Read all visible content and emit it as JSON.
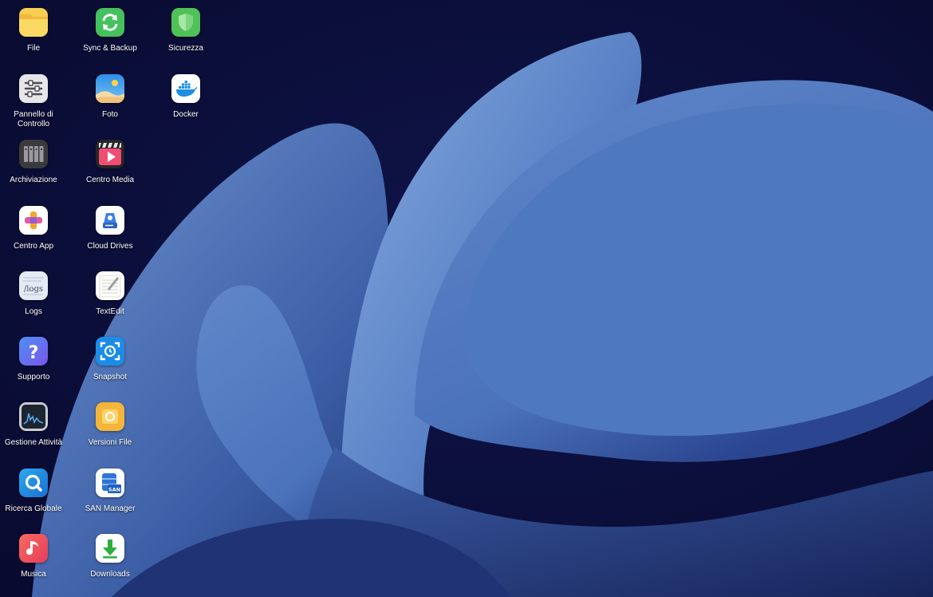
{
  "desktop": {
    "icons": [
      {
        "label": "File",
        "icon": "folder-icon",
        "color": "#f7c948"
      },
      {
        "label": "Pannello di Controllo",
        "icon": "control-panel-icon",
        "color": "#e4e4e4"
      },
      {
        "label": "Archiviazione",
        "icon": "storage-icon",
        "color": "#3a3a3a"
      },
      {
        "label": "Centro App",
        "icon": "app-center-icon",
        "color": "#ffffff"
      },
      {
        "label": "Logs",
        "icon": "logs-icon",
        "color": "#e9eef5"
      },
      {
        "label": "Supporto",
        "icon": "support-icon",
        "color": "#5b6ef5"
      },
      {
        "label": "Gestione Attività",
        "icon": "activity-monitor-icon",
        "color": "#1e2a35"
      },
      {
        "label": "Ricerca Globale",
        "icon": "global-search-icon",
        "color": "#1e8fe0"
      },
      {
        "label": "Musica",
        "icon": "music-icon",
        "color": "#f0515e"
      },
      {
        "label": "Sync & Backup",
        "icon": "sync-backup-icon",
        "color": "#3cbf5a"
      },
      {
        "label": "Foto",
        "icon": "photos-icon",
        "color": "#3d9de8"
      },
      {
        "label": "Centro Media",
        "icon": "media-center-icon",
        "color": "#2a2a2a"
      },
      {
        "label": "Cloud Drives",
        "icon": "cloud-drives-icon",
        "color": "#ffffff"
      },
      {
        "label": "TextEdit",
        "icon": "textedit-icon",
        "color": "#ffffff"
      },
      {
        "label": "Snapshot",
        "icon": "snapshot-icon",
        "color": "#1c8ee6"
      },
      {
        "label": "Versioni File",
        "icon": "file-versions-icon",
        "color": "#f4b63d"
      },
      {
        "label": "SAN Manager",
        "icon": "san-manager-icon",
        "color": "#ffffff"
      },
      {
        "label": "Downloads",
        "icon": "downloads-icon",
        "color": "#ffffff"
      },
      {
        "label": "Sicurezza",
        "icon": "shield-icon",
        "color": "#4cbf55"
      },
      {
        "label": "Docker",
        "icon": "docker-icon",
        "color": "#ffffff"
      }
    ]
  },
  "logs_icon_text": "/logs",
  "san_icon_text": "SAN"
}
